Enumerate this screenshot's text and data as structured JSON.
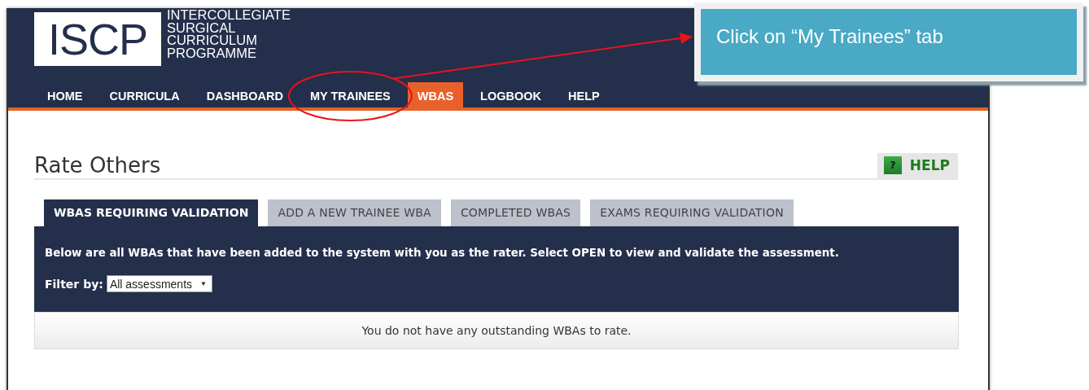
{
  "header": {
    "logo": {
      "mark": "ISCP",
      "lines": [
        "INTERCOLLEGIATE",
        "SURGICAL",
        "CURRICULUM",
        "PROGRAMME"
      ]
    },
    "nav": [
      {
        "label": "HOME",
        "selected": false,
        "circled": false
      },
      {
        "label": "CURRICULA",
        "selected": false,
        "circled": false
      },
      {
        "label": "DASHBOARD",
        "selected": false,
        "circled": false
      },
      {
        "label": "MY TRAINEES",
        "selected": false,
        "circled": true
      },
      {
        "label": "WBAS",
        "selected": true,
        "circled": false
      },
      {
        "label": "LOGBOOK",
        "selected": false,
        "circled": false
      },
      {
        "label": "HELP",
        "selected": false,
        "circled": false
      }
    ]
  },
  "page": {
    "title": "Rate Others",
    "help_icon": "?",
    "help_button": "HELP"
  },
  "tabs": [
    {
      "label": "WBAS REQUIRING VALIDATION",
      "selected": true
    },
    {
      "label": "ADD A NEW TRAINEE WBA",
      "selected": false
    },
    {
      "label": "COMPLETED WBAS",
      "selected": false
    },
    {
      "label": "EXAMS REQUIRING VALIDATION",
      "selected": false
    }
  ],
  "panel": {
    "description": "Below are all WBAs that have been added to the system with you as the rater. Select OPEN to view and validate the assessment.",
    "filter": {
      "label": "Filter by:",
      "value": "All assessments",
      "caret": "▼"
    }
  },
  "message": "You do not have any outstanding WBAs to rate.",
  "callout": {
    "text": "Click on “My Trainees” tab"
  }
}
